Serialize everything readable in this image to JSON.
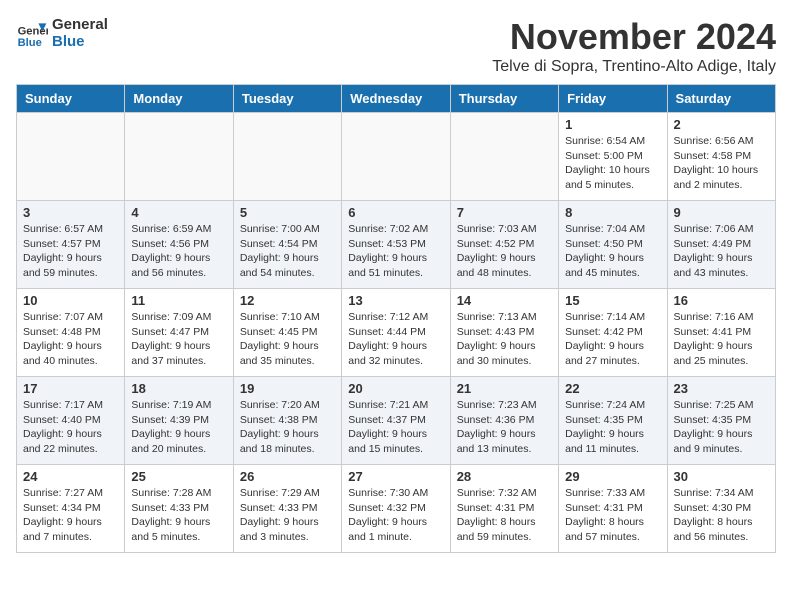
{
  "logo": {
    "line1": "General",
    "line2": "Blue"
  },
  "title": "November 2024",
  "subtitle": "Telve di Sopra, Trentino-Alto Adige, Italy",
  "weekdays": [
    "Sunday",
    "Monday",
    "Tuesday",
    "Wednesday",
    "Thursday",
    "Friday",
    "Saturday"
  ],
  "weeks": [
    [
      {
        "day": "",
        "info": ""
      },
      {
        "day": "",
        "info": ""
      },
      {
        "day": "",
        "info": ""
      },
      {
        "day": "",
        "info": ""
      },
      {
        "day": "",
        "info": ""
      },
      {
        "day": "1",
        "info": "Sunrise: 6:54 AM\nSunset: 5:00 PM\nDaylight: 10 hours and 5 minutes."
      },
      {
        "day": "2",
        "info": "Sunrise: 6:56 AM\nSunset: 4:58 PM\nDaylight: 10 hours and 2 minutes."
      }
    ],
    [
      {
        "day": "3",
        "info": "Sunrise: 6:57 AM\nSunset: 4:57 PM\nDaylight: 9 hours and 59 minutes."
      },
      {
        "day": "4",
        "info": "Sunrise: 6:59 AM\nSunset: 4:56 PM\nDaylight: 9 hours and 56 minutes."
      },
      {
        "day": "5",
        "info": "Sunrise: 7:00 AM\nSunset: 4:54 PM\nDaylight: 9 hours and 54 minutes."
      },
      {
        "day": "6",
        "info": "Sunrise: 7:02 AM\nSunset: 4:53 PM\nDaylight: 9 hours and 51 minutes."
      },
      {
        "day": "7",
        "info": "Sunrise: 7:03 AM\nSunset: 4:52 PM\nDaylight: 9 hours and 48 minutes."
      },
      {
        "day": "8",
        "info": "Sunrise: 7:04 AM\nSunset: 4:50 PM\nDaylight: 9 hours and 45 minutes."
      },
      {
        "day": "9",
        "info": "Sunrise: 7:06 AM\nSunset: 4:49 PM\nDaylight: 9 hours and 43 minutes."
      }
    ],
    [
      {
        "day": "10",
        "info": "Sunrise: 7:07 AM\nSunset: 4:48 PM\nDaylight: 9 hours and 40 minutes."
      },
      {
        "day": "11",
        "info": "Sunrise: 7:09 AM\nSunset: 4:47 PM\nDaylight: 9 hours and 37 minutes."
      },
      {
        "day": "12",
        "info": "Sunrise: 7:10 AM\nSunset: 4:45 PM\nDaylight: 9 hours and 35 minutes."
      },
      {
        "day": "13",
        "info": "Sunrise: 7:12 AM\nSunset: 4:44 PM\nDaylight: 9 hours and 32 minutes."
      },
      {
        "day": "14",
        "info": "Sunrise: 7:13 AM\nSunset: 4:43 PM\nDaylight: 9 hours and 30 minutes."
      },
      {
        "day": "15",
        "info": "Sunrise: 7:14 AM\nSunset: 4:42 PM\nDaylight: 9 hours and 27 minutes."
      },
      {
        "day": "16",
        "info": "Sunrise: 7:16 AM\nSunset: 4:41 PM\nDaylight: 9 hours and 25 minutes."
      }
    ],
    [
      {
        "day": "17",
        "info": "Sunrise: 7:17 AM\nSunset: 4:40 PM\nDaylight: 9 hours and 22 minutes."
      },
      {
        "day": "18",
        "info": "Sunrise: 7:19 AM\nSunset: 4:39 PM\nDaylight: 9 hours and 20 minutes."
      },
      {
        "day": "19",
        "info": "Sunrise: 7:20 AM\nSunset: 4:38 PM\nDaylight: 9 hours and 18 minutes."
      },
      {
        "day": "20",
        "info": "Sunrise: 7:21 AM\nSunset: 4:37 PM\nDaylight: 9 hours and 15 minutes."
      },
      {
        "day": "21",
        "info": "Sunrise: 7:23 AM\nSunset: 4:36 PM\nDaylight: 9 hours and 13 minutes."
      },
      {
        "day": "22",
        "info": "Sunrise: 7:24 AM\nSunset: 4:35 PM\nDaylight: 9 hours and 11 minutes."
      },
      {
        "day": "23",
        "info": "Sunrise: 7:25 AM\nSunset: 4:35 PM\nDaylight: 9 hours and 9 minutes."
      }
    ],
    [
      {
        "day": "24",
        "info": "Sunrise: 7:27 AM\nSunset: 4:34 PM\nDaylight: 9 hours and 7 minutes."
      },
      {
        "day": "25",
        "info": "Sunrise: 7:28 AM\nSunset: 4:33 PM\nDaylight: 9 hours and 5 minutes."
      },
      {
        "day": "26",
        "info": "Sunrise: 7:29 AM\nSunset: 4:33 PM\nDaylight: 9 hours and 3 minutes."
      },
      {
        "day": "27",
        "info": "Sunrise: 7:30 AM\nSunset: 4:32 PM\nDaylight: 9 hours and 1 minute."
      },
      {
        "day": "28",
        "info": "Sunrise: 7:32 AM\nSunset: 4:31 PM\nDaylight: 8 hours and 59 minutes."
      },
      {
        "day": "29",
        "info": "Sunrise: 7:33 AM\nSunset: 4:31 PM\nDaylight: 8 hours and 57 minutes."
      },
      {
        "day": "30",
        "info": "Sunrise: 7:34 AM\nSunset: 4:30 PM\nDaylight: 8 hours and 56 minutes."
      }
    ]
  ]
}
